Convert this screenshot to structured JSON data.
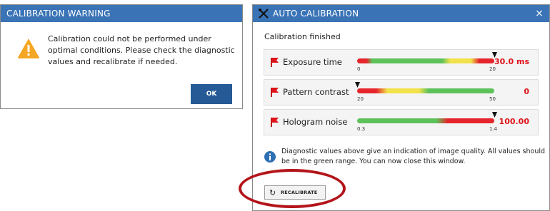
{
  "warning_dialog": {
    "title": "CALIBRATION WARNING",
    "icon": "warning-triangle-icon",
    "message": "Calibration could not be performed under optimal conditions. Please check the diagnostic values and recalibrate if needed.",
    "ok_label": "OK"
  },
  "auto_dialog": {
    "title": "AUTO CALIBRATION",
    "close_label": "×",
    "status": "Calibration finished",
    "rows": [
      {
        "label": "Exposure time",
        "min": "0",
        "max": "20",
        "value": "30.0 ms",
        "marker_fraction": 1.0
      },
      {
        "label": "Pattern contrast",
        "min": "20",
        "max": "50",
        "value": "0",
        "marker_fraction": 0.0
      },
      {
        "label": "Hologram noise",
        "min": "0.3",
        "max": "1.4",
        "value": "100.00",
        "marker_fraction": 1.0
      }
    ],
    "info_text": "Diagnostic values above give an indication of image quality. All values should be in the green range. You can now close this window.",
    "recalibrate_label": "RECALIBRATE"
  },
  "colors": {
    "title_bar": "#3a74b6",
    "ok_button": "#265a97",
    "value_red": "#e0131a",
    "highlight_ring": "#b3151a",
    "gauge_green": "#5ec25a",
    "gauge_yellow": "#f2e24a",
    "gauge_red": "#e5252b"
  }
}
